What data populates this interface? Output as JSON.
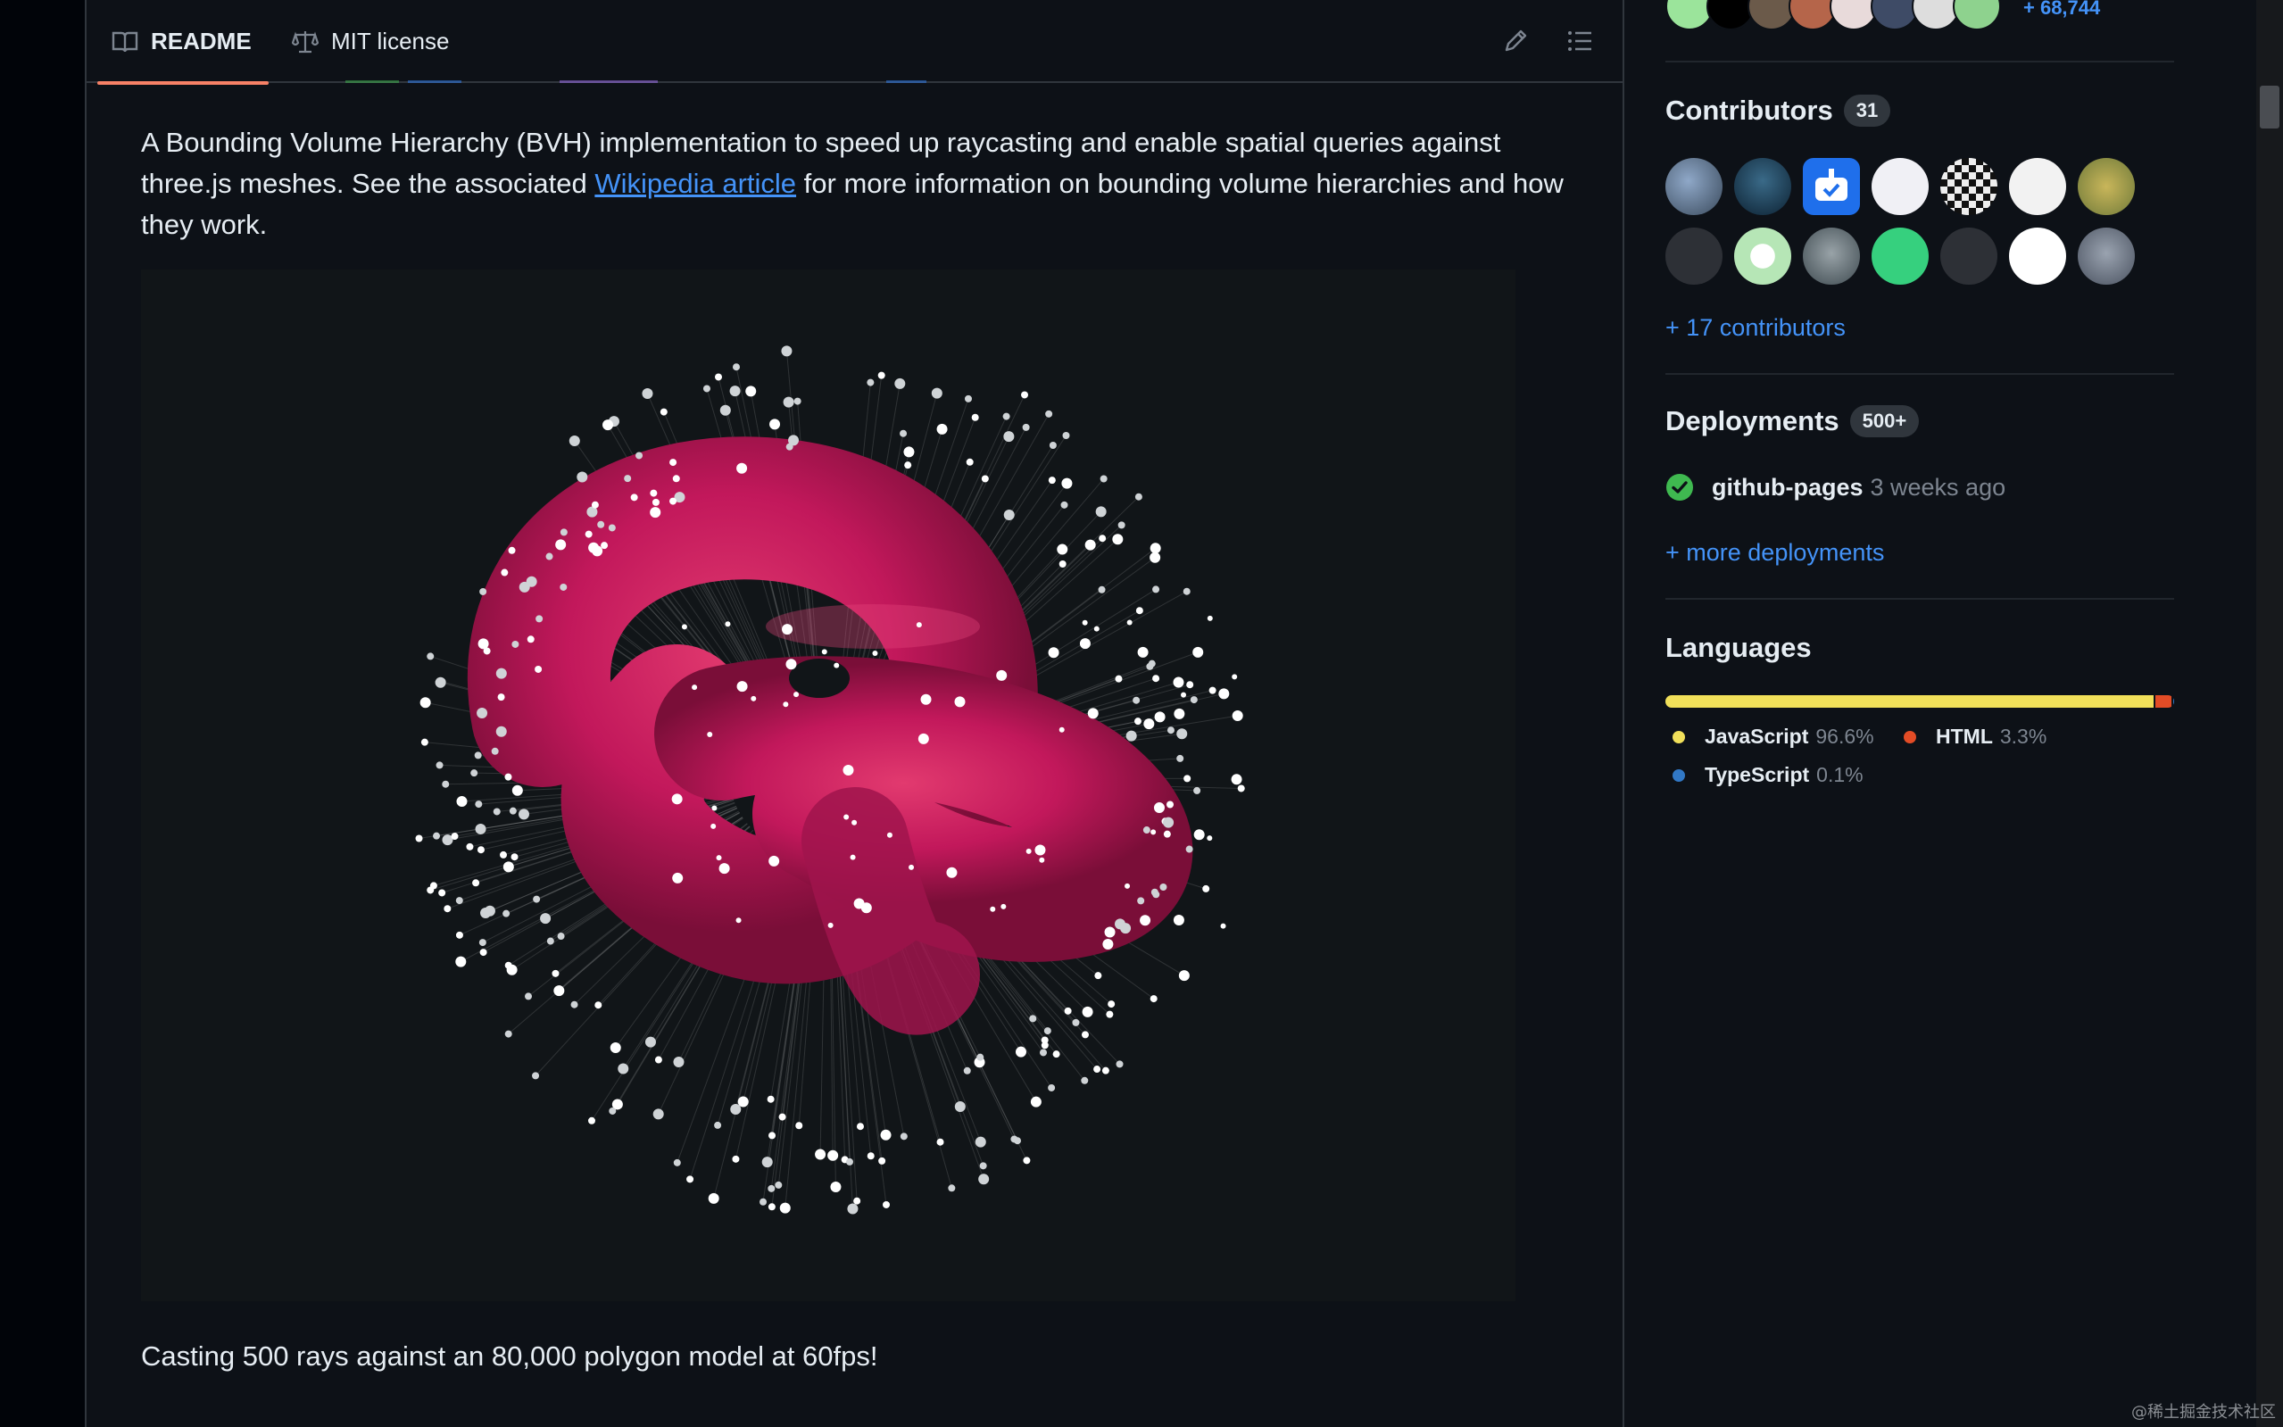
{
  "tabs": {
    "readme_label": "README",
    "license_label": "MIT license"
  },
  "toolbar": {
    "edit_icon": "pencil-icon",
    "outline_icon": "list-unordered-icon"
  },
  "readme": {
    "intro_before_link": "A Bounding Volume Hierarchy (BVH) implementation to speed up raycasting and enable spatial queries against three.js meshes. See the associated ",
    "intro_link": "Wikipedia article",
    "intro_after_link": " for more information on bounding volume hierarchies and how they work.",
    "figure_description": "raycasting demo: pink torus knot with rays and hit points",
    "caption": "Casting 500 rays against an 80,000 polygon model at 60fps!"
  },
  "sidebar": {
    "stars_more": "+ 68,744",
    "contributors": {
      "title": "Contributors",
      "count": "31",
      "more_link": "+ 17 contributors"
    },
    "deployments": {
      "title": "Deployments",
      "count": "500+",
      "env_name": "github-pages",
      "env_time": "3 weeks ago",
      "status_icon": "check-circle-icon",
      "more_link": "+ more deployments"
    },
    "languages": {
      "title": "Languages",
      "items": [
        {
          "name": "JavaScript",
          "percent": "96.6%",
          "color": "#f1e05a",
          "share": 96.6
        },
        {
          "name": "HTML",
          "percent": "3.3%",
          "color": "#e34c26",
          "share": 3.3
        },
        {
          "name": "TypeScript",
          "percent": "0.1%",
          "color": "#3178c6",
          "share": 0.1
        }
      ]
    }
  },
  "watermark": "@稀土掘金技术社区",
  "colors": {
    "link": "#4493f8",
    "tab_underline": "#f78166",
    "torus": "#c2185b",
    "success": "#3fb950"
  }
}
